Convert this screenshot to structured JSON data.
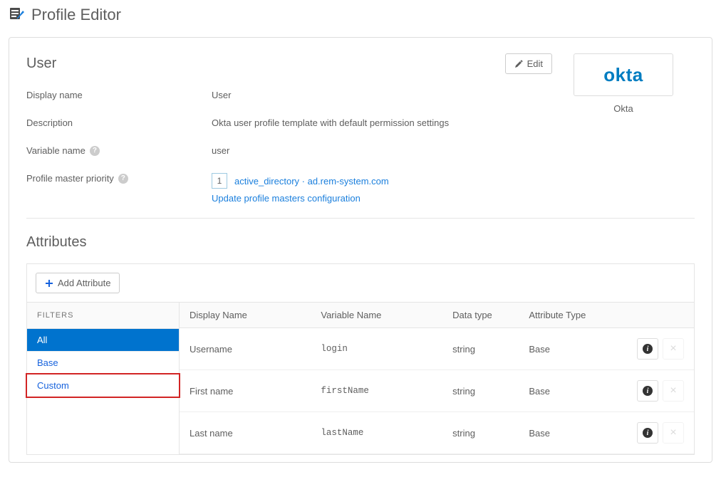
{
  "page": {
    "title": "Profile Editor"
  },
  "user_section": {
    "title": "User",
    "edit_label": "Edit",
    "display_name_label": "Display name",
    "display_name_value": "User",
    "description_label": "Description",
    "description_value": "Okta user profile template with default permission settings",
    "variable_name_label": "Variable name",
    "variable_name_value": "user",
    "priority_label": "Profile master priority",
    "priority_number": "1",
    "priority_link": "active_directory · ad.rem-system.com",
    "update_link": "Update profile masters configuration"
  },
  "logo": {
    "text": "okta",
    "caption": "Okta"
  },
  "attributes": {
    "title": "Attributes",
    "add_button": "Add Attribute",
    "filters_label": "FILTERS",
    "filters": {
      "all": "All",
      "base": "Base",
      "custom": "Custom"
    },
    "columns": {
      "display_name": "Display Name",
      "variable_name": "Variable Name",
      "data_type": "Data type",
      "attribute_type": "Attribute Type"
    },
    "rows": [
      {
        "display": "Username",
        "var": "login",
        "dtype": "string",
        "atype": "Base"
      },
      {
        "display": "First name",
        "var": "firstName",
        "dtype": "string",
        "atype": "Base"
      },
      {
        "display": "Last name",
        "var": "lastName",
        "dtype": "string",
        "atype": "Base"
      }
    ]
  }
}
